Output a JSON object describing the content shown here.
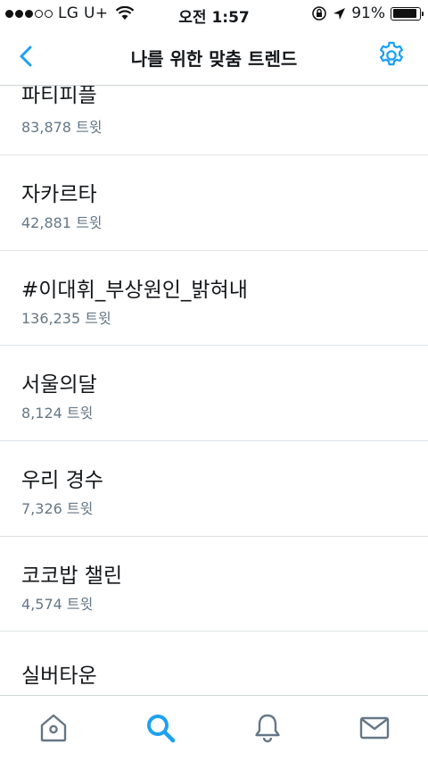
{
  "status_bar": {
    "carrier": "LG U+",
    "time": "오전 1:57",
    "battery": "91%",
    "battery_level": 0.91
  },
  "nav": {
    "title": "나를 위한 맞춤 트렌드",
    "back_icon": "chevron-left-icon",
    "settings_icon": "gear-icon"
  },
  "trends": [
    {
      "name": "파티피플",
      "count": "83,878 트윗"
    },
    {
      "name": "자카르타",
      "count": "42,881 트윗"
    },
    {
      "name": "#이대휘_부상원인_밝혀내",
      "count": "136,235 트윗"
    },
    {
      "name": "서울의달",
      "count": "8,124 트윗"
    },
    {
      "name": "우리 경수",
      "count": "7,326 트윗"
    },
    {
      "name": "코코밥 챌린",
      "count": "4,574 트윗"
    },
    {
      "name": "실버타운",
      "count": ""
    }
  ],
  "tabs": [
    {
      "name": "home",
      "icon": "home-icon"
    },
    {
      "name": "search",
      "icon": "search-icon",
      "active": true
    },
    {
      "name": "notifications",
      "icon": "bell-icon"
    },
    {
      "name": "messages",
      "icon": "mail-icon"
    }
  ],
  "colors": {
    "accent": "#1da1f2",
    "secondary_text": "#657786",
    "inactive_icon": "#657786"
  }
}
